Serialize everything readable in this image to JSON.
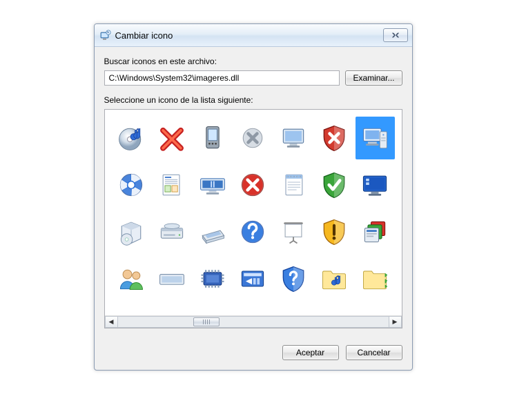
{
  "window": {
    "title": "Cambiar icono",
    "close_glyph": "✕"
  },
  "search": {
    "label": "Buscar iconos en este archivo:",
    "path_value": "C:\\Windows\\System32\\imageres.dll",
    "browse_label": "Examinar..."
  },
  "select": {
    "label": "Seleccione un icono de la lista siguiente:"
  },
  "scroll": {
    "left_glyph": "◀",
    "right_glyph": "▶"
  },
  "footer": {
    "ok_label": "Aceptar",
    "cancel_label": "Cancelar"
  },
  "icons": [
    {
      "name": "music-disc-icon",
      "selected": false
    },
    {
      "name": "red-x-icon",
      "selected": false
    },
    {
      "name": "pda-device-icon",
      "selected": false
    },
    {
      "name": "gray-x-icon",
      "selected": false
    },
    {
      "name": "monitor-icon",
      "selected": false
    },
    {
      "name": "shield-red-x-icon",
      "selected": false
    },
    {
      "name": "computer-icon",
      "selected": true
    },
    {
      "name": "blue-segment-disc-icon",
      "selected": false
    },
    {
      "name": "document-preview-icon",
      "selected": false
    },
    {
      "name": "widescreen-icon",
      "selected": false
    },
    {
      "name": "error-red-circle-icon",
      "selected": false
    },
    {
      "name": "notepad-icon",
      "selected": false
    },
    {
      "name": "shield-green-check-icon",
      "selected": false
    },
    {
      "name": "desktop-blue-icon",
      "selected": false
    },
    {
      "name": "software-box-icon",
      "selected": false
    },
    {
      "name": "disk-drive-icon",
      "selected": false
    },
    {
      "name": "scanner-icon",
      "selected": false
    },
    {
      "name": "help-question-icon",
      "selected": false
    },
    {
      "name": "projector-screen-icon",
      "selected": false
    },
    {
      "name": "shield-warning-icon",
      "selected": false
    },
    {
      "name": "programs-stack-icon",
      "selected": false
    },
    {
      "name": "users-group-icon",
      "selected": false
    },
    {
      "name": "panel-wide-icon",
      "selected": false
    },
    {
      "name": "memory-chip-icon",
      "selected": false
    },
    {
      "name": "run-dialog-icon",
      "selected": false
    },
    {
      "name": "shield-question-icon",
      "selected": false
    },
    {
      "name": "music-folder-icon",
      "selected": false
    },
    {
      "name": "folder-arrow-icon",
      "selected": false
    }
  ]
}
